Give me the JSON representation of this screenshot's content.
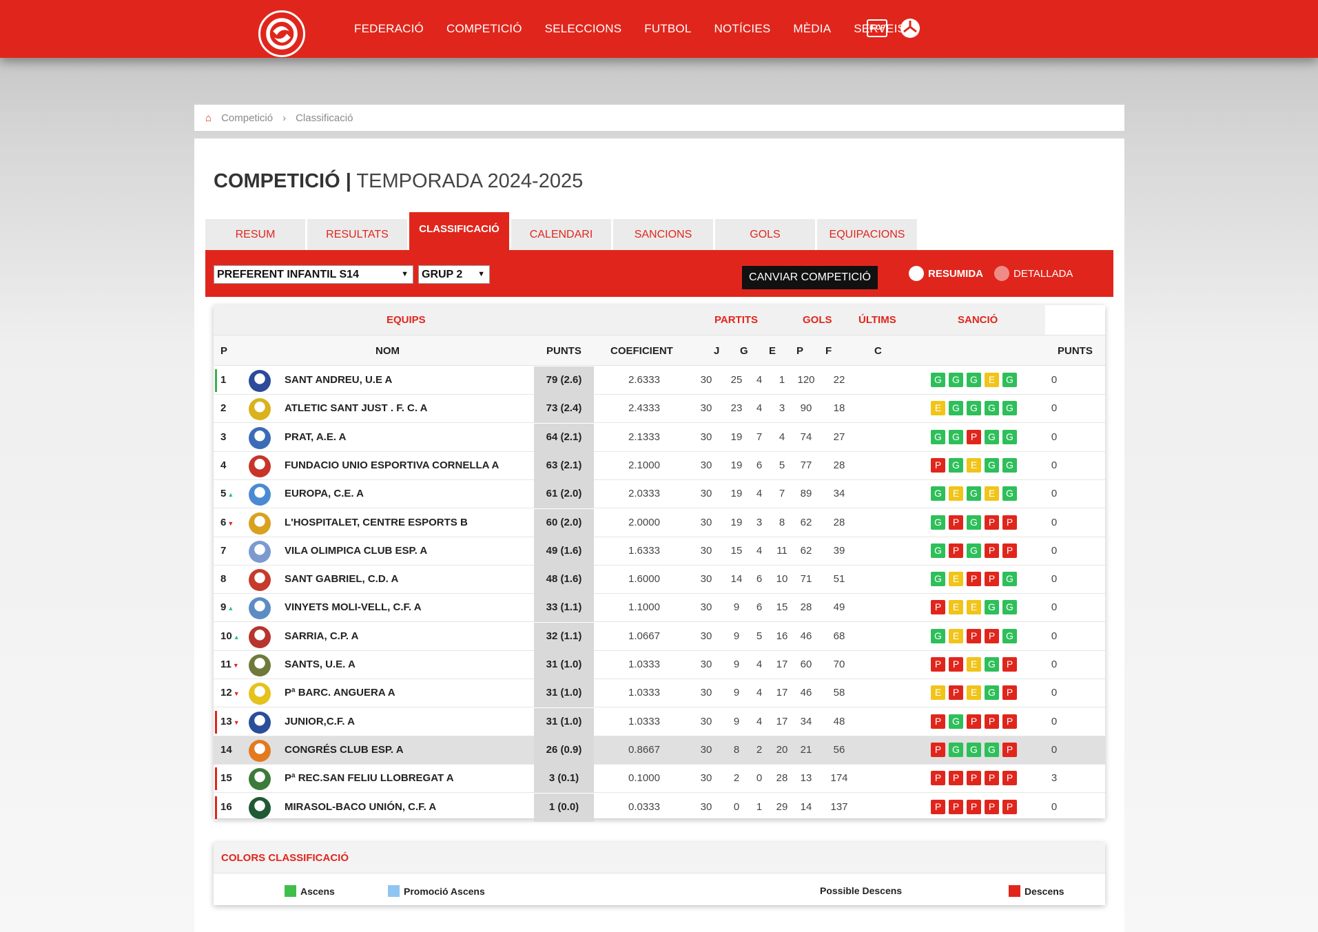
{
  "nav": {
    "items": [
      "FEDERACIÓ",
      "COMPETICIÓ",
      "SELECCIONS",
      "FUTBOL",
      "NOTÍCIES",
      "MÈDIA",
      "SERVEIS"
    ],
    "ifcf_label": "iFCF"
  },
  "breadcrumb": {
    "items": [
      "Competició",
      "Classificació"
    ],
    "separator": "›"
  },
  "title": {
    "main": "COMPETICIÓ |",
    "season": "TEMPORADA 2024-2025"
  },
  "tabs": [
    {
      "label": "RESUM",
      "active": false
    },
    {
      "label": "RESULTATS",
      "active": false
    },
    {
      "label": "CLASSIFICACIÓ",
      "active": true
    },
    {
      "label": "CALENDARI",
      "active": false
    },
    {
      "label": "SANCIONS",
      "active": false
    },
    {
      "label": "GOLS",
      "active": false
    },
    {
      "label": "EQUIPACIONS",
      "active": false
    }
  ],
  "filters": {
    "competition": "PREFERENT INFANTIL S14",
    "group": "GRUP 2",
    "change_button": "CANVIAR COMPETICIÓ",
    "view_summary": "RESUMIDA",
    "view_detail": "DETALLADA"
  },
  "table": {
    "group_headers": {
      "teams": "EQUIPS",
      "matches": "PARTITS",
      "goals": "GOLS",
      "last": "ÚLTIMS",
      "sanction": "SANCIÓ"
    },
    "columns": {
      "p": "P",
      "name": "NOM",
      "points": "PUNTS",
      "coef": "COEFICIENT",
      "j": "J",
      "g": "G",
      "e": "E",
      "pp": "P",
      "f": "F",
      "c": "C",
      "sanction_points": "PUNTS"
    },
    "rows": [
      {
        "pos": "1",
        "trend": "",
        "name": "SANT ANDREU, U.E A",
        "points": "79 (2.6)",
        "coef": "2.6333",
        "j": "30",
        "g": "25",
        "e": "4",
        "p": "1",
        "f": "120",
        "c": "22",
        "last": [
          "G",
          "G",
          "G",
          "E",
          "G"
        ],
        "sanc": "0",
        "edge": "#3fae49",
        "crest": "#2c4a9a",
        "hl": false
      },
      {
        "pos": "2",
        "trend": "",
        "name": "ATLETIC SANT JUST . F. C. A",
        "points": "73 (2.4)",
        "coef": "2.4333",
        "j": "30",
        "g": "23",
        "e": "4",
        "p": "3",
        "f": "90",
        "c": "18",
        "last": [
          "E",
          "G",
          "G",
          "G",
          "G"
        ],
        "sanc": "0",
        "edge": "",
        "crest": "#d9b21c",
        "hl": false
      },
      {
        "pos": "3",
        "trend": "",
        "name": "PRAT, A.E. A",
        "points": "64 (2.1)",
        "coef": "2.1333",
        "j": "30",
        "g": "19",
        "e": "7",
        "p": "4",
        "f": "74",
        "c": "27",
        "last": [
          "G",
          "G",
          "P",
          "G",
          "G"
        ],
        "sanc": "0",
        "edge": "",
        "crest": "#3b6cb6",
        "hl": false
      },
      {
        "pos": "4",
        "trend": "",
        "name": "FUNDACIO UNIO ESPORTIVA CORNELLA A",
        "points": "63 (2.1)",
        "coef": "2.1000",
        "j": "30",
        "g": "19",
        "e": "6",
        "p": "5",
        "f": "77",
        "c": "28",
        "last": [
          "P",
          "G",
          "E",
          "G",
          "G"
        ],
        "sanc": "0",
        "edge": "",
        "crest": "#c8332a",
        "hl": false
      },
      {
        "pos": "5",
        "trend": "up",
        "name": "EUROPA, C.E. A",
        "points": "61 (2.0)",
        "coef": "2.0333",
        "j": "30",
        "g": "19",
        "e": "4",
        "p": "7",
        "f": "89",
        "c": "34",
        "last": [
          "G",
          "E",
          "G",
          "E",
          "G"
        ],
        "sanc": "0",
        "edge": "",
        "crest": "#4a8ad4",
        "hl": false
      },
      {
        "pos": "6",
        "trend": "down",
        "name": "L'HOSPITALET, CENTRE ESPORTS B",
        "points": "60 (2.0)",
        "coef": "2.0000",
        "j": "30",
        "g": "19",
        "e": "3",
        "p": "8",
        "f": "62",
        "c": "28",
        "last": [
          "G",
          "P",
          "G",
          "P",
          "P"
        ],
        "sanc": "0",
        "edge": "",
        "crest": "#d8a21f",
        "hl": false
      },
      {
        "pos": "7",
        "trend": "",
        "name": "VILA OLIMPICA CLUB ESP. A",
        "points": "49 (1.6)",
        "coef": "1.6333",
        "j": "30",
        "g": "15",
        "e": "4",
        "p": "11",
        "f": "62",
        "c": "39",
        "last": [
          "G",
          "P",
          "G",
          "P",
          "P"
        ],
        "sanc": "0",
        "edge": "",
        "crest": "#7d9ad0",
        "hl": false
      },
      {
        "pos": "8",
        "trend": "",
        "name": "SANT GABRIEL, C.D. A",
        "points": "48 (1.6)",
        "coef": "1.6000",
        "j": "30",
        "g": "14",
        "e": "6",
        "p": "10",
        "f": "71",
        "c": "51",
        "last": [
          "G",
          "E",
          "P",
          "P",
          "G"
        ],
        "sanc": "0",
        "edge": "",
        "crest": "#c63a2c",
        "hl": false
      },
      {
        "pos": "9",
        "trend": "up",
        "name": "VINYETS MOLI-VELL, C.F. A",
        "points": "33 (1.1)",
        "coef": "1.1000",
        "j": "30",
        "g": "9",
        "e": "6",
        "p": "15",
        "f": "28",
        "c": "49",
        "last": [
          "P",
          "E",
          "E",
          "G",
          "G"
        ],
        "sanc": "0",
        "edge": "",
        "crest": "#5d8cc4",
        "hl": false
      },
      {
        "pos": "10",
        "trend": "up",
        "name": "SARRIA, C.P. A",
        "points": "32 (1.1)",
        "coef": "1.0667",
        "j": "30",
        "g": "9",
        "e": "5",
        "p": "16",
        "f": "46",
        "c": "68",
        "last": [
          "G",
          "E",
          "P",
          "P",
          "G"
        ],
        "sanc": "0",
        "edge": "",
        "crest": "#b8342e",
        "hl": false
      },
      {
        "pos": "11",
        "trend": "down",
        "name": "SANTS, U.E. A",
        "points": "31 (1.0)",
        "coef": "1.0333",
        "j": "30",
        "g": "9",
        "e": "4",
        "p": "17",
        "f": "60",
        "c": "70",
        "last": [
          "P",
          "P",
          "E",
          "G",
          "P"
        ],
        "sanc": "0",
        "edge": "",
        "crest": "#6f7a3a",
        "hl": false
      },
      {
        "pos": "12",
        "trend": "down",
        "name": "Pª BARC. ANGUERA A",
        "points": "31 (1.0)",
        "coef": "1.0333",
        "j": "30",
        "g": "9",
        "e": "4",
        "p": "17",
        "f": "46",
        "c": "58",
        "last": [
          "E",
          "P",
          "E",
          "G",
          "P"
        ],
        "sanc": "0",
        "edge": "",
        "crest": "#e5c21c",
        "hl": false
      },
      {
        "pos": "13",
        "trend": "down",
        "name": "JUNIOR,C.F. A",
        "points": "31 (1.0)",
        "coef": "1.0333",
        "j": "30",
        "g": "9",
        "e": "4",
        "p": "17",
        "f": "34",
        "c": "48",
        "last": [
          "P",
          "G",
          "P",
          "P",
          "P"
        ],
        "sanc": "0",
        "edge": "#e0261c",
        "crest": "#2a4e9a",
        "hl": false
      },
      {
        "pos": "14",
        "trend": "",
        "name": "CONGRÉS CLUB ESP. A",
        "points": "26 (0.9)",
        "coef": "0.8667",
        "j": "30",
        "g": "8",
        "e": "2",
        "p": "20",
        "f": "21",
        "c": "56",
        "last": [
          "P",
          "G",
          "G",
          "G",
          "P"
        ],
        "sanc": "0",
        "edge": "",
        "crest": "#e37a1f",
        "hl": true
      },
      {
        "pos": "15",
        "trend": "",
        "name": "Pª REC.SAN FELIU LLOBREGAT A",
        "points": "3 (0.1)",
        "coef": "0.1000",
        "j": "30",
        "g": "2",
        "e": "0",
        "p": "28",
        "f": "13",
        "c": "174",
        "last": [
          "P",
          "P",
          "P",
          "P",
          "P"
        ],
        "sanc": "3",
        "edge": "#e0261c",
        "crest": "#3c7a3a",
        "hl": false
      },
      {
        "pos": "16",
        "trend": "",
        "name": "MIRASOL-BACO UNIÓN, C.F. A",
        "points": "1 (0.0)",
        "coef": "0.0333",
        "j": "30",
        "g": "0",
        "e": "1",
        "p": "29",
        "f": "14",
        "c": "137",
        "last": [
          "P",
          "P",
          "P",
          "P",
          "P"
        ],
        "sanc": "0",
        "edge": "#e0261c",
        "crest": "#1f5a34",
        "hl": false
      }
    ]
  },
  "legend": {
    "title": "COLORS CLASSIFICACIÓ",
    "items": [
      {
        "label": "Ascens",
        "color": "#3fbf4a"
      },
      {
        "label": "Promoció Ascens",
        "color": "#8fc5f0"
      },
      {
        "label": "Possible Descens",
        "color": ""
      },
      {
        "label": "Descens",
        "color": "#e0261c"
      }
    ]
  },
  "colors": {
    "brand": "#e0261c",
    "win": "#2ebf5a",
    "draw": "#f0c419",
    "loss": "#e0261c"
  }
}
